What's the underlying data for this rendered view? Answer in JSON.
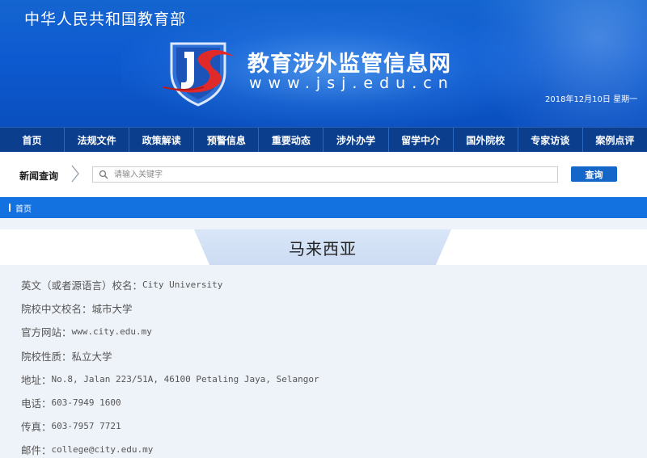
{
  "header": {
    "ministry": "中华人民共和国教育部",
    "site_title": "教育涉外监管信息网",
    "site_domain": "www.jsj.edu.cn",
    "date": "2018年12月10日 星期一"
  },
  "nav": {
    "items": [
      {
        "label": "首页"
      },
      {
        "label": "法规文件"
      },
      {
        "label": "政策解读"
      },
      {
        "label": "预警信息"
      },
      {
        "label": "重要动态"
      },
      {
        "label": "涉外办学"
      },
      {
        "label": "留学中介"
      },
      {
        "label": "国外院校"
      },
      {
        "label": "专家访谈"
      },
      {
        "label": "案例点评"
      }
    ]
  },
  "search": {
    "label": "新闻查询",
    "placeholder": "请输入关键字",
    "button": "查询"
  },
  "breadcrumb": {
    "home": "首页"
  },
  "content": {
    "heading": "马来西亚",
    "rows": [
      {
        "key": "英文（或者源语言）校名：",
        "value": "City University"
      },
      {
        "key": "院校中文校名：",
        "value": "城市大学"
      },
      {
        "key": "官方网站：",
        "value": "www.city.edu.my"
      },
      {
        "key": "院校性质：",
        "value": "私立大学"
      },
      {
        "key": "地址：",
        "value": "No.8, Jalan 223/51A, 46100 Petaling Jaya, Selangor"
      },
      {
        "key": "电话：",
        "value": "603-7949 1600"
      },
      {
        "key": "传真：",
        "value": "603-7957 7721"
      },
      {
        "key": "邮件：",
        "value": "college@city.edu.my"
      }
    ]
  },
  "colors": {
    "banner": "#0d5ad0",
    "nav": "#0b3f8e",
    "accent": "#1466c8",
    "breadcrumb": "#1472e0",
    "content_bg": "#eef2f9"
  },
  "icons": {
    "logo": "js-shield-logo",
    "search": "magnifier-icon",
    "separator": "chevron-right-icon"
  }
}
